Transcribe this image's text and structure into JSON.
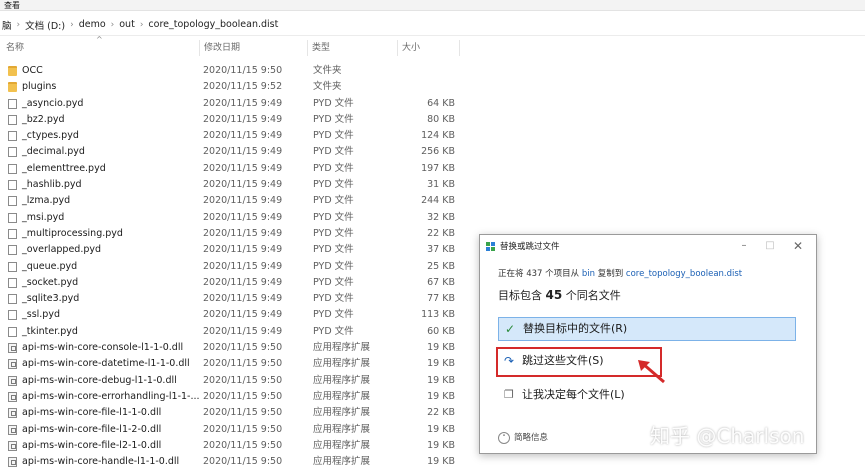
{
  "window": {
    "menu_label": "查看"
  },
  "address": {
    "crumbs": [
      "脑",
      "文档 (D:)",
      "demo",
      "out",
      "core_topology_boolean.dist"
    ]
  },
  "columns": {
    "name": "名称",
    "date": "修改日期",
    "type": "类型",
    "size": "大小"
  },
  "files": [
    {
      "name": "OCC",
      "date": "2020/11/15 9:50",
      "type": "文件夹",
      "size": "",
      "kind": "folder"
    },
    {
      "name": "plugins",
      "date": "2020/11/15 9:52",
      "type": "文件夹",
      "size": "",
      "kind": "folder"
    },
    {
      "name": "_asyncio.pyd",
      "date": "2020/11/15 9:49",
      "type": "PYD 文件",
      "size": "64 KB",
      "kind": "file"
    },
    {
      "name": "_bz2.pyd",
      "date": "2020/11/15 9:49",
      "type": "PYD 文件",
      "size": "80 KB",
      "kind": "file"
    },
    {
      "name": "_ctypes.pyd",
      "date": "2020/11/15 9:49",
      "type": "PYD 文件",
      "size": "124 KB",
      "kind": "file"
    },
    {
      "name": "_decimal.pyd",
      "date": "2020/11/15 9:49",
      "type": "PYD 文件",
      "size": "256 KB",
      "kind": "file"
    },
    {
      "name": "_elementtree.pyd",
      "date": "2020/11/15 9:49",
      "type": "PYD 文件",
      "size": "197 KB",
      "kind": "file"
    },
    {
      "name": "_hashlib.pyd",
      "date": "2020/11/15 9:49",
      "type": "PYD 文件",
      "size": "31 KB",
      "kind": "file"
    },
    {
      "name": "_lzma.pyd",
      "date": "2020/11/15 9:49",
      "type": "PYD 文件",
      "size": "244 KB",
      "kind": "file"
    },
    {
      "name": "_msi.pyd",
      "date": "2020/11/15 9:49",
      "type": "PYD 文件",
      "size": "32 KB",
      "kind": "file"
    },
    {
      "name": "_multiprocessing.pyd",
      "date": "2020/11/15 9:49",
      "type": "PYD 文件",
      "size": "22 KB",
      "kind": "file"
    },
    {
      "name": "_overlapped.pyd",
      "date": "2020/11/15 9:49",
      "type": "PYD 文件",
      "size": "37 KB",
      "kind": "file"
    },
    {
      "name": "_queue.pyd",
      "date": "2020/11/15 9:49",
      "type": "PYD 文件",
      "size": "25 KB",
      "kind": "file"
    },
    {
      "name": "_socket.pyd",
      "date": "2020/11/15 9:49",
      "type": "PYD 文件",
      "size": "67 KB",
      "kind": "file"
    },
    {
      "name": "_sqlite3.pyd",
      "date": "2020/11/15 9:49",
      "type": "PYD 文件",
      "size": "77 KB",
      "kind": "file"
    },
    {
      "name": "_ssl.pyd",
      "date": "2020/11/15 9:49",
      "type": "PYD 文件",
      "size": "113 KB",
      "kind": "file"
    },
    {
      "name": "_tkinter.pyd",
      "date": "2020/11/15 9:49",
      "type": "PYD 文件",
      "size": "60 KB",
      "kind": "file"
    },
    {
      "name": "api-ms-win-core-console-l1-1-0.dll",
      "date": "2020/11/15 9:50",
      "type": "应用程序扩展",
      "size": "19 KB",
      "kind": "dll"
    },
    {
      "name": "api-ms-win-core-datetime-l1-1-0.dll",
      "date": "2020/11/15 9:50",
      "type": "应用程序扩展",
      "size": "19 KB",
      "kind": "dll"
    },
    {
      "name": "api-ms-win-core-debug-l1-1-0.dll",
      "date": "2020/11/15 9:50",
      "type": "应用程序扩展",
      "size": "19 KB",
      "kind": "dll"
    },
    {
      "name": "api-ms-win-core-errorhandling-l1-1-...",
      "date": "2020/11/15 9:50",
      "type": "应用程序扩展",
      "size": "19 KB",
      "kind": "dll"
    },
    {
      "name": "api-ms-win-core-file-l1-1-0.dll",
      "date": "2020/11/15 9:50",
      "type": "应用程序扩展",
      "size": "22 KB",
      "kind": "dll"
    },
    {
      "name": "api-ms-win-core-file-l1-2-0.dll",
      "date": "2020/11/15 9:50",
      "type": "应用程序扩展",
      "size": "19 KB",
      "kind": "dll"
    },
    {
      "name": "api-ms-win-core-file-l2-1-0.dll",
      "date": "2020/11/15 9:50",
      "type": "应用程序扩展",
      "size": "19 KB",
      "kind": "dll"
    },
    {
      "name": "api-ms-win-core-handle-l1-1-0.dll",
      "date": "2020/11/15 9:50",
      "type": "应用程序扩展",
      "size": "19 KB",
      "kind": "dll"
    }
  ],
  "dialog": {
    "title": "替换或跳过文件",
    "progress_prefix": "正在将 437 个项目从 ",
    "source": "bin",
    "progress_mid": " 复制到 ",
    "dest": "core_topology_boolean.dist",
    "conflict_prefix": "目标包含 ",
    "conflict_count": "45",
    "conflict_suffix": " 个同名文件",
    "option_replace": "替换目标中的文件(R)",
    "option_skip": "跳过这些文件(S)",
    "option_decide": "让我决定每个文件(L)",
    "details": "简略信息"
  },
  "watermark": "知乎 @Charlson",
  "colors": {
    "highlight_red": "#d42a2a",
    "selected_blue": "#d5e8fa",
    "link_blue": "#1a5fb4"
  }
}
